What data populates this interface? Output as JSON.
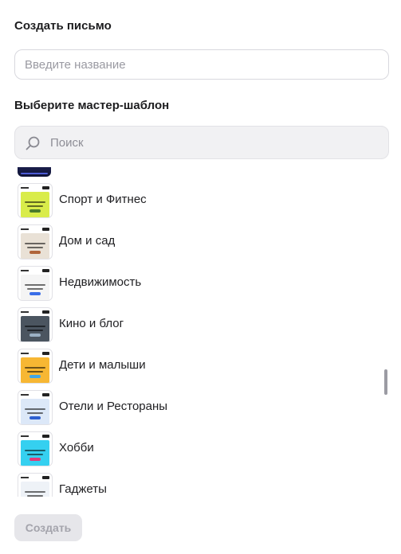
{
  "create_letter": {
    "title": "Создать письмо",
    "name_placeholder": "Введите название",
    "name_value": ""
  },
  "master_template": {
    "title": "Выберите мастер-шаблон",
    "search_placeholder": "Поиск",
    "search_icon": "search-icon"
  },
  "templates": [
    {
      "label": "Спорт и Фитнес",
      "theme": {
        "bg": "#ffffff",
        "hero": "#d9ec4a",
        "accent": "#4a7a2a"
      }
    },
    {
      "label": "Дом и сад",
      "theme": {
        "bg": "#ffffff",
        "hero": "#e9e1d6",
        "accent": "#b0643a"
      }
    },
    {
      "label": "Недвижимость",
      "theme": {
        "bg": "#ffffff",
        "hero": "#f4f4f4",
        "accent": "#3a6ee8"
      }
    },
    {
      "label": "Кино и блог",
      "theme": {
        "bg": "#ffffff",
        "hero": "#4b5560",
        "accent": "#9bb0c4"
      }
    },
    {
      "label": "Дети и малыши",
      "theme": {
        "bg": "#ffffff",
        "hero": "#f7b733",
        "accent": "#41a6e6"
      }
    },
    {
      "label": "Отели и Рестораны",
      "theme": {
        "bg": "#ffffff",
        "hero": "#dce8f8",
        "accent": "#2d5fd0"
      }
    },
    {
      "label": "Хобби",
      "theme": {
        "bg": "#ffffff",
        "hero": "#35d0f0",
        "accent": "#e03b7a"
      }
    },
    {
      "label": "Гаджеты",
      "theme": {
        "bg": "#ffffff",
        "hero": "#eef2f7",
        "accent": "#3a8ee0"
      }
    }
  ],
  "footer": {
    "create_label": "Создать",
    "create_enabled": false
  },
  "colors": {
    "text": "#1f1f22",
    "placeholder": "#9a9aa2",
    "input_border": "#d8d8de",
    "search_bg": "#f1f1f3",
    "button_disabled_bg": "#e6e6ea",
    "button_disabled_text": "#a4a4ac"
  }
}
